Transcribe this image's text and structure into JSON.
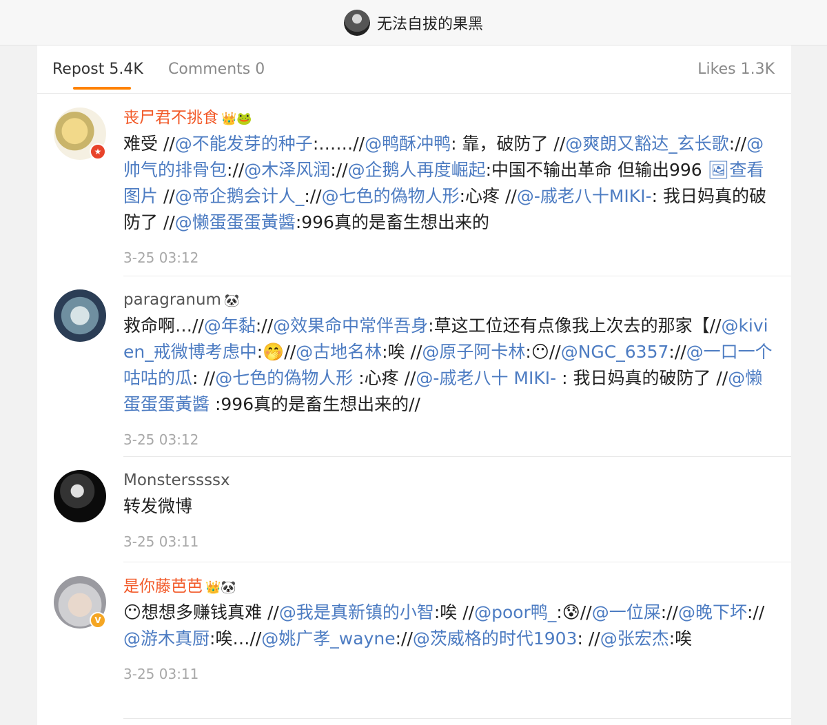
{
  "header": {
    "title": "无法自拔的果黑"
  },
  "tabs": {
    "repost": "Repost 5.4K",
    "comments": "Comments 0",
    "likes": "Likes 1.3K"
  },
  "colors": {
    "accent": "#ff8200",
    "link": "#4d7cc2",
    "name_orange": "#f25a29"
  },
  "posts": [
    {
      "name": "丧尸君不挑食",
      "emoji": "👑🐸",
      "text_html": "难受 //<span class=\"at\">@不能发芽的种子</span>:……//<span class=\"at\">@鸭酥冲鸭</span>: 靠，破防了 //<span class=\"at\">@爽朗又豁达_玄长歌</span>://<span class=\"at\">@帅气的排骨包</span>://<span class=\"at\">@木泽风润</span>://<span class=\"at\">@企鹅人再度崛起</span>:中国不输出革命 但输出996 <span class=\"at\">🖼查看图片</span> //<span class=\"at\">@帝企鹅会计人_</span>://<span class=\"at\">@七色的偽物人形</span>:心疼 //<span class=\"at\">@-戚老八十MIKI-</span>: 我日妈真的破防了 //<span class=\"at\">@懒蛋蛋蛋黃醬</span>:996真的是畜生想出来的",
      "time": "3-25 03:12"
    },
    {
      "name": "paragranum",
      "emoji": "🐼",
      "text_html": "救命啊…//<span class=\"at\">@年黏</span>://<span class=\"at\">@效果命中常伴吾身</span>:草这工位还有点像我上次去的那家【//<span class=\"at\">@kivien_戒微博考虑中</span>:🤭//<span class=\"at\">@古地名林</span>:唉 //<span class=\"at\">@原子阿卡林</span>:😶//<span class=\"at\">@NGC_6357</span>://<span class=\"at\">@一口一个咕咕的瓜</span>: //<span class=\"at\">@七色的偽物人形</span> :心疼 //<span class=\"at\">@-戚老八十 MIKI-</span> : 我日妈真的破防了 //<span class=\"at\">@懒蛋蛋蛋黃醬</span> :996真的是畜生想出来的//",
      "time": "3-25 03:12"
    },
    {
      "name": "Monsterssssx",
      "emoji": "",
      "text_html": "转发微博",
      "time": "3-25 03:11"
    },
    {
      "name": "是你藤芭芭",
      "emoji": "👑🐼",
      "text_html": "😶想想多赚钱真难 //<span class=\"at\">@我是真新镇的小智</span>:唉 //<span class=\"at\">@poor鸭_</span>:😰//<span class=\"at\">@一位屎</span>://<span class=\"at\">@晚下坏</span>://<span class=\"at\">@游木真厨</span>:唉…//<span class=\"at\">@姚广孝_wayne</span>://<span class=\"at\">@茨威格的时代1903</span>: //<span class=\"at\">@张宏杰</span>:唉",
      "time": "3-25 03:11"
    }
  ]
}
